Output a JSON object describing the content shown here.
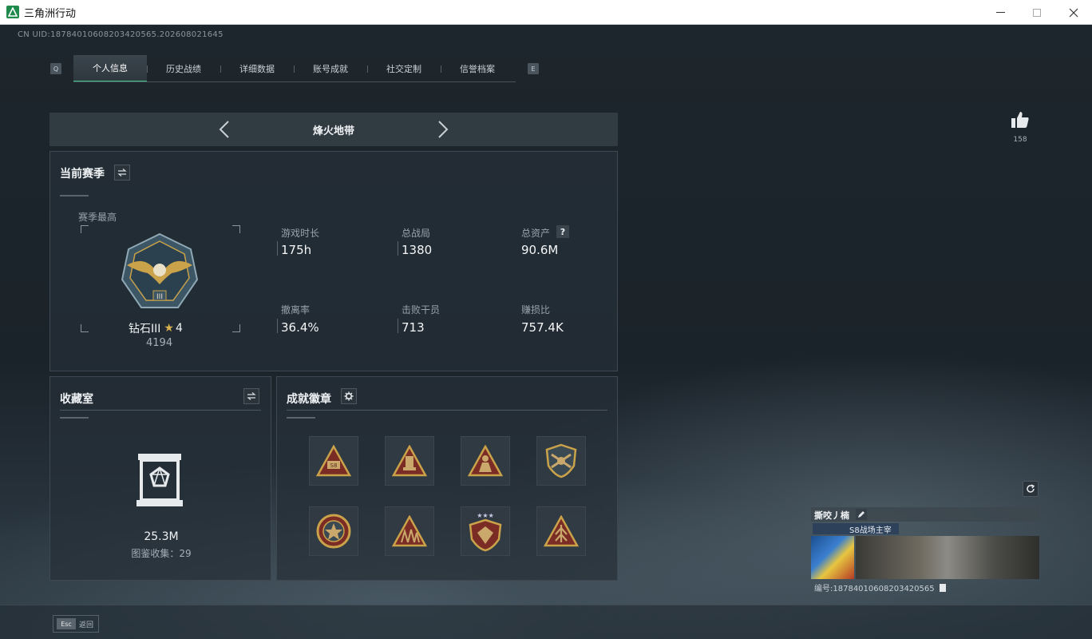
{
  "window": {
    "title": "三角洲行动"
  },
  "uid_text": "CN UID:18784010608203420565.202608021645",
  "tabs": {
    "left_key": "Q",
    "right_key": "E",
    "items": [
      "个人信息",
      "历史战绩",
      "详细数据",
      "账号成就",
      "社交定制",
      "信誉档案"
    ],
    "active_index": 0
  },
  "mode": {
    "title": "烽火地带"
  },
  "season": {
    "title": "当前赛季",
    "best_label": "赛季最高",
    "rank_name": "钻石III",
    "rank_stars": "4",
    "rank_score": "4194",
    "stats": [
      {
        "label": "游戏时长",
        "value": "175h"
      },
      {
        "label": "总战局",
        "value": "1380"
      },
      {
        "label": "总资产",
        "value": "90.6M"
      },
      {
        "label": "撤离率",
        "value": "36.4%"
      },
      {
        "label": "击败干员",
        "value": "713"
      },
      {
        "label": "赚损比",
        "value": "757.4K"
      }
    ],
    "help_icon": "?"
  },
  "collection": {
    "title": "收藏室",
    "value": "25.3M",
    "catalog_text": "图鉴收集：29"
  },
  "achievements": {
    "title": "成就徽章",
    "badges": [
      "badge-1",
      "badge-2",
      "badge-3",
      "badge-4",
      "badge-5",
      "badge-6",
      "badge-7",
      "badge-8"
    ]
  },
  "likes": {
    "count": "158"
  },
  "player_card": {
    "name": "撕咬丿楠",
    "tag": "S8战场主宰",
    "id_text": "编号:18784010608203420565"
  },
  "footer": {
    "esc_key": "Esc",
    "back_label": "返回"
  },
  "colors": {
    "accent": "#3fc58a",
    "gold": "#c9a24a"
  }
}
